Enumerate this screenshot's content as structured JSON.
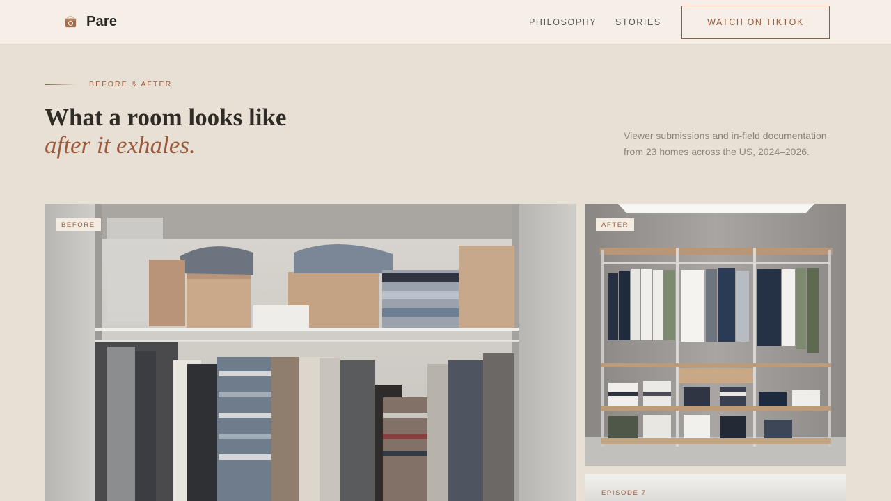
{
  "nav": {
    "brand": "Pare",
    "logo_icon": "box-logo-icon",
    "links": [
      "PHILOSOPHY",
      "STORIES"
    ],
    "cta": "WATCH ON TIKTOK"
  },
  "hero": {
    "eyebrow": "BEFORE & AFTER",
    "title_line1": "What a room looks like",
    "title_line2": "after it exhales.",
    "description": "Viewer submissions and in-field documentation from 23 homes across the US, 2024–2026."
  },
  "gallery": {
    "before_tag": "BEFORE",
    "after_tag": "AFTER",
    "episode_tag": "EPISODE 7"
  },
  "colors": {
    "accent": "#9a5a3b",
    "page_bg": "#e8e0d4",
    "nav_bg": "#f5efe8",
    "text": "#2f2c28",
    "muted": "#8a837b"
  }
}
